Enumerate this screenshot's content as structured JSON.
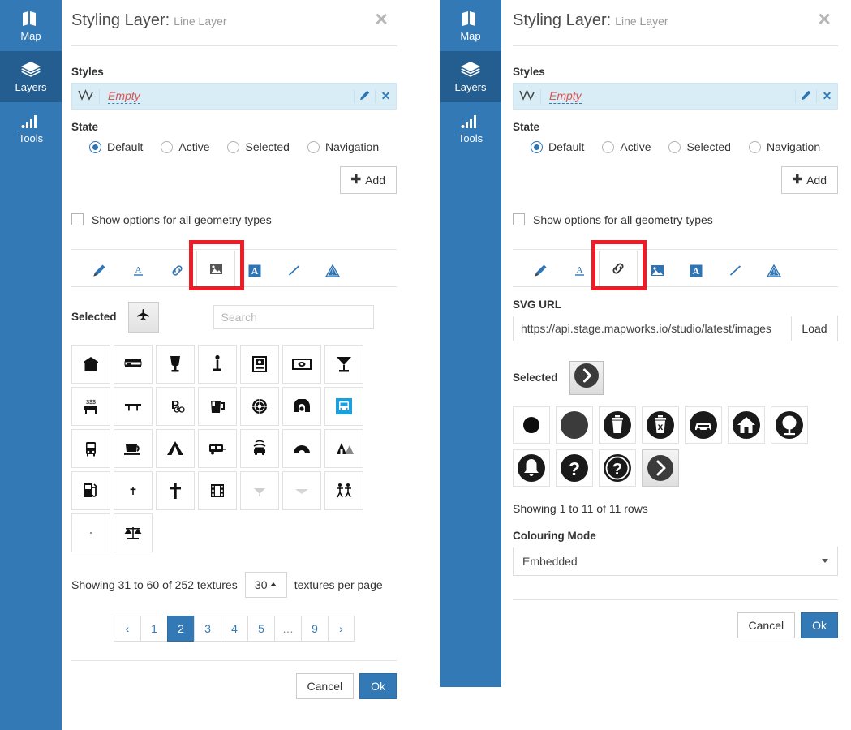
{
  "sidebar": {
    "items": [
      {
        "label": "Map",
        "icon": "map-icon",
        "active": false
      },
      {
        "label": "Layers",
        "icon": "layers-icon",
        "active": true
      },
      {
        "label": "Tools",
        "icon": "tools-icon",
        "active": false
      }
    ]
  },
  "colors": {
    "brand_blue": "#3279b6",
    "sidebar_active": "#245d8f",
    "highlight_red": "#ec1d26",
    "styles_row_bg": "#d9edf7",
    "empty_text": "#d9534f",
    "link_blue": "#337ab7"
  },
  "header": {
    "title": "Styling Layer:",
    "subtitle": "Line Layer",
    "close_icon": "close-icon"
  },
  "styles": {
    "label": "Styles",
    "row_glyph": "line-geometry-icon",
    "row_name": "Empty",
    "edit_icon": "pencil-icon",
    "delete_icon": "close-icon"
  },
  "state": {
    "label": "State",
    "options": [
      {
        "label": "Default",
        "selected": true
      },
      {
        "label": "Active",
        "selected": false
      },
      {
        "label": "Selected",
        "selected": false
      },
      {
        "label": "Navigation",
        "selected": false
      }
    ]
  },
  "add_button": {
    "label": "Add",
    "icon": "plus-icon"
  },
  "geometry_checkbox": {
    "label": "Show options for all geometry types",
    "checked": false
  },
  "icon_tabs": [
    {
      "name": "brush-icon",
      "selected_left": false,
      "selected_right": false
    },
    {
      "name": "text-underline-icon",
      "selected_left": false,
      "selected_right": false
    },
    {
      "name": "link-icon",
      "selected_left": false,
      "selected_right": true
    },
    {
      "name": "image-icon",
      "selected_left": true,
      "selected_right": false
    },
    {
      "name": "letter-a-box-icon",
      "selected_left": false,
      "selected_right": false
    },
    {
      "name": "line-icon",
      "selected_left": false,
      "selected_right": false
    },
    {
      "name": "warning-triangle-icon",
      "selected_left": false,
      "selected_right": false
    }
  ],
  "left_panel": {
    "selected_label": "Selected",
    "selected_swatch_icon": "airplane-icon",
    "search_placeholder": "Search",
    "search_value": "",
    "textures": [
      {
        "icon": "shelter-icon"
      },
      {
        "icon": "bed-icon"
      },
      {
        "icon": "trophy-icon"
      },
      {
        "icon": "monument-icon"
      },
      {
        "icon": "atm-icon"
      },
      {
        "icon": "banknote-icon"
      },
      {
        "icon": "cocktail-icon"
      },
      {
        "icon": "money-bench-icon"
      },
      {
        "icon": "picnic-table-icon"
      },
      {
        "icon": "bike-parking-icon"
      },
      {
        "icon": "beer-mug-icon"
      },
      {
        "icon": "target-icon"
      },
      {
        "icon": "tunnel-icon"
      },
      {
        "icon": "bus-station-blue-icon"
      },
      {
        "icon": "bus-icon"
      },
      {
        "icon": "coffee-cup-icon"
      },
      {
        "icon": "tent-icon"
      },
      {
        "icon": "caravan-icon"
      },
      {
        "icon": "car-wash-icon"
      },
      {
        "icon": "dome-icon"
      },
      {
        "icon": "mountain-hut-icon"
      },
      {
        "icon": "fuel-pump-icon"
      },
      {
        "icon": "small-cross-icon"
      },
      {
        "icon": "cross-icon"
      },
      {
        "icon": "film-icon"
      },
      {
        "icon": "faint-tree-icon"
      },
      {
        "icon": "faint-line-icon"
      },
      {
        "icon": "playground-icon"
      },
      {
        "icon": "dot-icon"
      },
      {
        "icon": "scales-icon"
      }
    ],
    "showing_text": "Showing 31 to 60 of 252 textures",
    "per_page_value": "30",
    "per_page_suffix": "textures per page",
    "pagination": [
      "‹",
      "1",
      "2",
      "3",
      "4",
      "5",
      "…",
      "9",
      "›"
    ],
    "pagination_active": "2",
    "footer": {
      "cancel": "Cancel",
      "ok": "Ok"
    }
  },
  "right_panel": {
    "svg_url_label": "SVG URL",
    "svg_url_value": "https://api.stage.mapworks.io/studio/latest/images",
    "load_label": "Load",
    "selected_label": "Selected",
    "selected_swatch_icon": "chevron-right-circle-icon",
    "svg_icons": [
      {
        "icon": "small-filled-circle-icon"
      },
      {
        "icon": "large-filled-circle-icon"
      },
      {
        "icon": "trash-circle-icon"
      },
      {
        "icon": "trash-x-circle-icon"
      },
      {
        "icon": "car-circle-icon"
      },
      {
        "icon": "home-circle-icon"
      },
      {
        "icon": "tree-circle-icon"
      },
      {
        "icon": "bell-circle-icon"
      },
      {
        "icon": "question-circle-icon"
      },
      {
        "icon": "question-ring-circle-icon"
      },
      {
        "icon": "chevron-right-circle-icon"
      }
    ],
    "svg_selected_index": 10,
    "rows_text": "Showing 1 to 11 of 11 rows",
    "colouring_mode_label": "Colouring Mode",
    "colouring_mode_value": "Embedded",
    "footer": {
      "cancel": "Cancel",
      "ok": "Ok"
    }
  }
}
